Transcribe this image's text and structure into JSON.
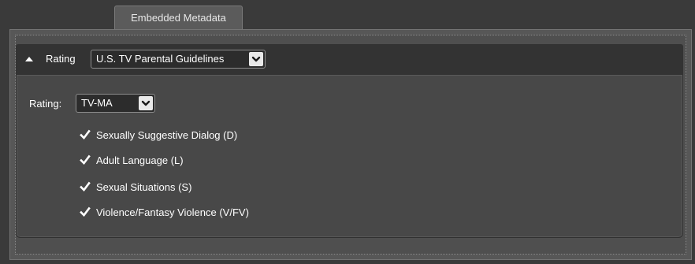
{
  "tabs": [
    {
      "label": "Embedded Metadata",
      "active": true
    }
  ],
  "group": {
    "header_label": "Rating",
    "standard": {
      "value": "U.S. TV Parental Guidelines"
    },
    "collapse_icon": "triangle-up-icon"
  },
  "rating": {
    "label": "Rating:",
    "value": "TV-MA"
  },
  "content_descriptors": [
    {
      "label": "Sexually Suggestive Dialog (D)",
      "checked": true
    },
    {
      "label": "Adult Language (L)",
      "checked": true
    },
    {
      "label": "Sexual Situations (S)",
      "checked": true
    },
    {
      "label": "Violence/Fantasy Violence (V/FV)",
      "checked": true
    }
  ],
  "colors": {
    "background": "#3a3a3a",
    "header_bar": "#333333",
    "body_panel": "#484848",
    "dropdown_arrow_bg": "#e9e9e9"
  }
}
